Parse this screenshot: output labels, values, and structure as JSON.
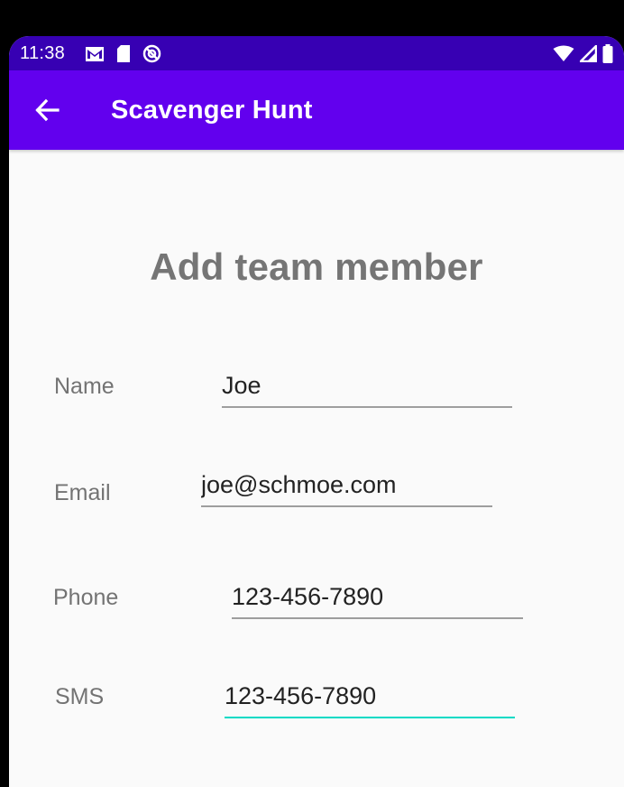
{
  "status_bar": {
    "time": "11:38",
    "left_icons": [
      "gmail-icon",
      "sd-card-icon",
      "do-not-disturb-icon"
    ],
    "right_icons": [
      "wifi-icon",
      "cell-signal-icon",
      "battery-icon"
    ]
  },
  "app_bar": {
    "back_icon": "arrow-back-icon",
    "title": "Scavenger Hunt"
  },
  "form": {
    "title": "Add team member",
    "fields": [
      {
        "label": "Name",
        "value": "Joe"
      },
      {
        "label": "Email",
        "value": "joe@schmoe.com"
      },
      {
        "label": "Phone",
        "value": "123-456-7890"
      },
      {
        "label": "SMS",
        "value": "123-456-7890",
        "focused": true
      }
    ]
  },
  "colors": {
    "status_bar": "#3700b3",
    "app_bar": "#6200ee",
    "focus_underline": "#03dac5",
    "background": "#fafafa"
  }
}
